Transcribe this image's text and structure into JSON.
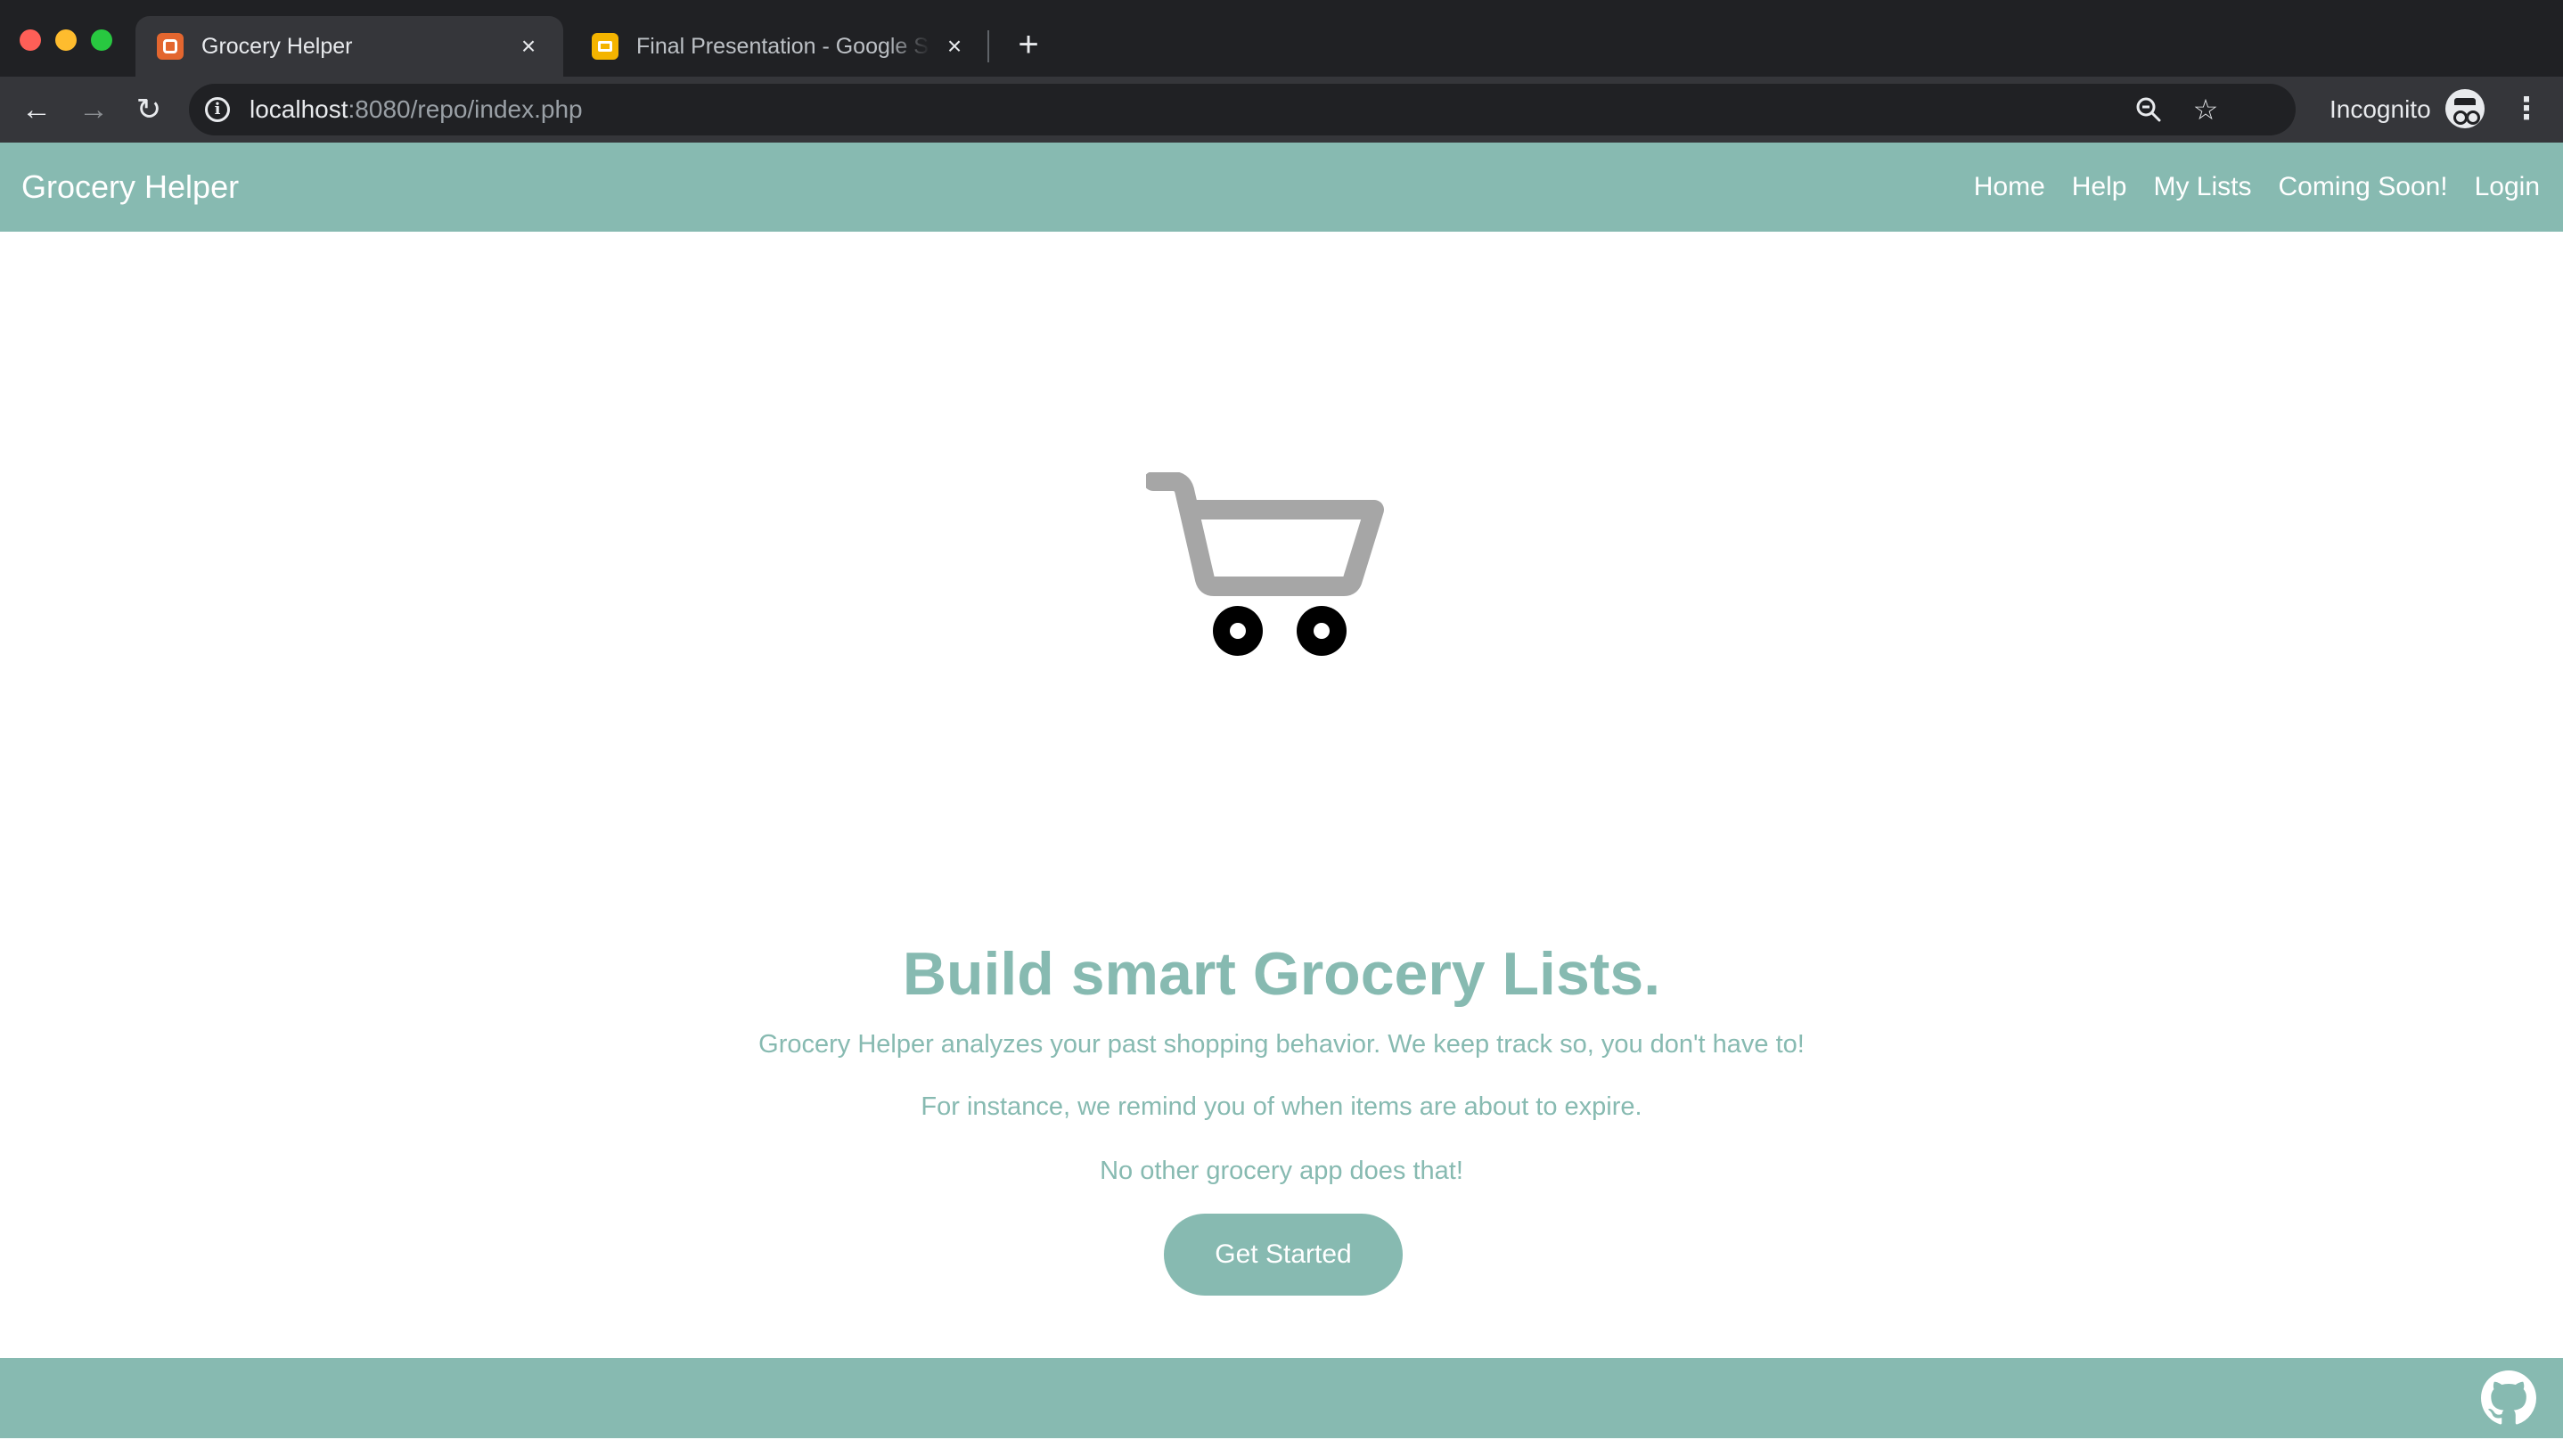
{
  "browser": {
    "tabs": [
      {
        "title": "Grocery Helper",
        "active": true,
        "favicon": "xampp-icon"
      },
      {
        "title": "Final Presentation - Google Slides",
        "active": false,
        "favicon": "google-slides-icon"
      }
    ],
    "new_tab_symbol": "+",
    "url_host": "localhost",
    "url_rest": ":8080/repo/index.php",
    "incognito_label": "Incognito"
  },
  "site": {
    "brand": "Grocery Helper",
    "nav": [
      "Home",
      "Help",
      "My Lists",
      "Coming Soon!",
      "Login"
    ],
    "hero": {
      "title": "Build smart Grocery Lists.",
      "lines": [
        "Grocery Helper analyzes your past shopping behavior. We keep track so, you don't have to!",
        "For instance, we remind you of when items are about to expire.",
        "No other grocery app does that!"
      ],
      "cta": "Get Started",
      "image_icon": "shopping-cart-icon"
    },
    "footer": {
      "icon": "github-icon"
    }
  },
  "colors": {
    "brand": "#87bab1",
    "chrome_dark": "#202124",
    "chrome_toolbar": "#35363a",
    "cart_gray": "#a6a6a6",
    "wheels": "#000000"
  }
}
